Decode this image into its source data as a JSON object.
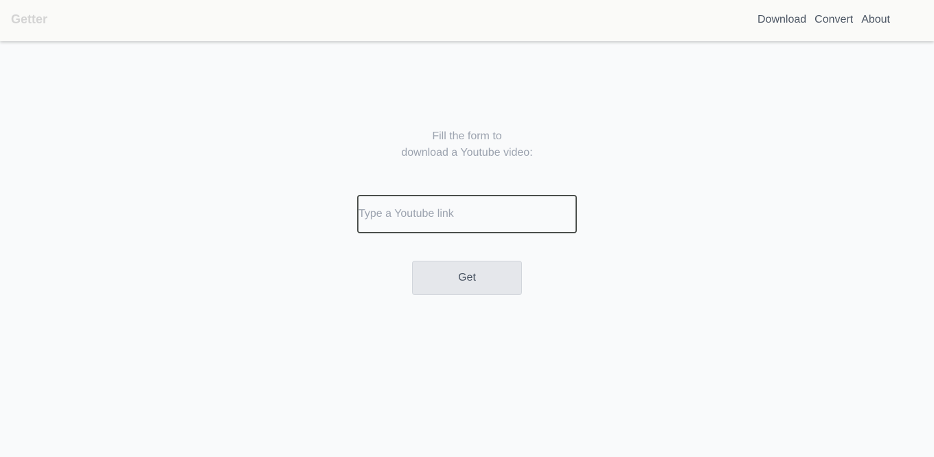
{
  "header": {
    "brand": "Getter",
    "nav": [
      {
        "label": "Download"
      },
      {
        "label": "Convert"
      },
      {
        "label": "About"
      }
    ]
  },
  "form": {
    "intro_line1": "Fill the form to",
    "intro_line2": "download a Youtube video:",
    "input_placeholder": "Type a Youtube link",
    "input_value": "",
    "submit_label": "Get"
  }
}
